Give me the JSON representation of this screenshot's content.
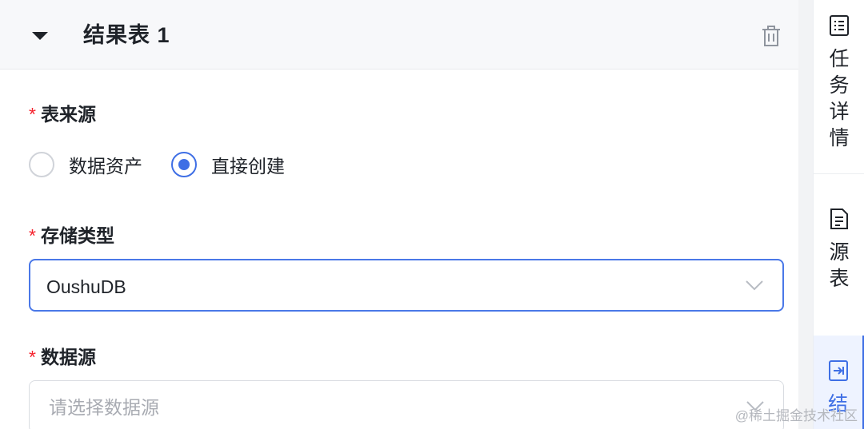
{
  "panel": {
    "title": "结果表 1"
  },
  "fields": {
    "table_source": {
      "required_mark": "*",
      "label": "表来源",
      "options": [
        {
          "label": "数据资产",
          "checked": false
        },
        {
          "label": "直接创建",
          "checked": true
        }
      ]
    },
    "storage_type": {
      "required_mark": "*",
      "label": "存储类型",
      "value": "OushuDB"
    },
    "data_source": {
      "required_mark": "*",
      "label": "数据源",
      "placeholder": "请选择数据源"
    }
  },
  "side_tabs": [
    {
      "label": "任务详情",
      "icon": "list-doc-icon",
      "active": false
    },
    {
      "label": "源表",
      "icon": "doc-icon",
      "active": false
    },
    {
      "label": "结",
      "icon": "export-doc-icon",
      "active": true
    }
  ],
  "watermark": "@稀土掘金技术社区",
  "colors": {
    "accent": "#3f6fe5",
    "required": "#f5222d",
    "header_bg": "#f7f8fa"
  }
}
